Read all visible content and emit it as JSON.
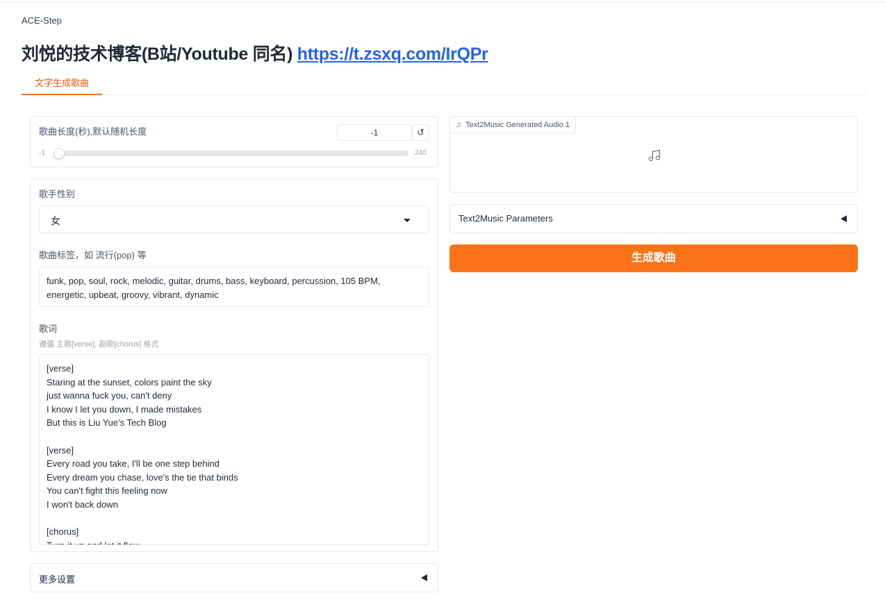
{
  "app": {
    "name": "ACE-Step",
    "title": "刘悦的技术博客(B站/Youtube 同名)",
    "link_text": "https://t.zsxq.com/IrQPr"
  },
  "tabs": [
    {
      "label": "文字生成歌曲",
      "active": true
    }
  ],
  "duration": {
    "label": "歌曲长度(秒),默认随机长度",
    "value": "-1",
    "min": "-1",
    "max": "240",
    "reset_icon": "reset-icon",
    "slider_fraction": 0
  },
  "gender": {
    "label": "歌手性别",
    "selected": "女"
  },
  "tags": {
    "label": "歌曲标签，如 流行(pop) 等",
    "value": "funk, pop, soul, rock, melodic, guitar, drums, bass, keyboard, percussion, 105 BPM, energetic, upbeat, groovy, vibrant, dynamic"
  },
  "lyrics": {
    "label": "歌词",
    "info": "遵循 主歌[verse], 副歌[chorus] 格式",
    "value": "[verse]\nStaring at the sunset, colors paint the sky\njust wanna fuck you, can't deny\nI know I let you down, I made mistakes\nBut this is Liu Yue's Tech Blog\n\n[verse]\nEvery road you take, I'll be one step behind\nEvery dream you chase, love's the tie that binds\nYou can't fight this feeling now\nI won't back down\n\n[chorus]\nTurn it up and let it flow"
  },
  "more_settings": {
    "label": "更多设置"
  },
  "audio_output": {
    "label": "Text2Music Generated Audio 1",
    "icon": "music-note-icon"
  },
  "params": {
    "label": "Text2Music Parameters"
  },
  "generate_button": {
    "label": "生成歌曲"
  },
  "colors": {
    "accent": "#f97316",
    "link": "#2563eb",
    "border": "#e5e7eb"
  }
}
